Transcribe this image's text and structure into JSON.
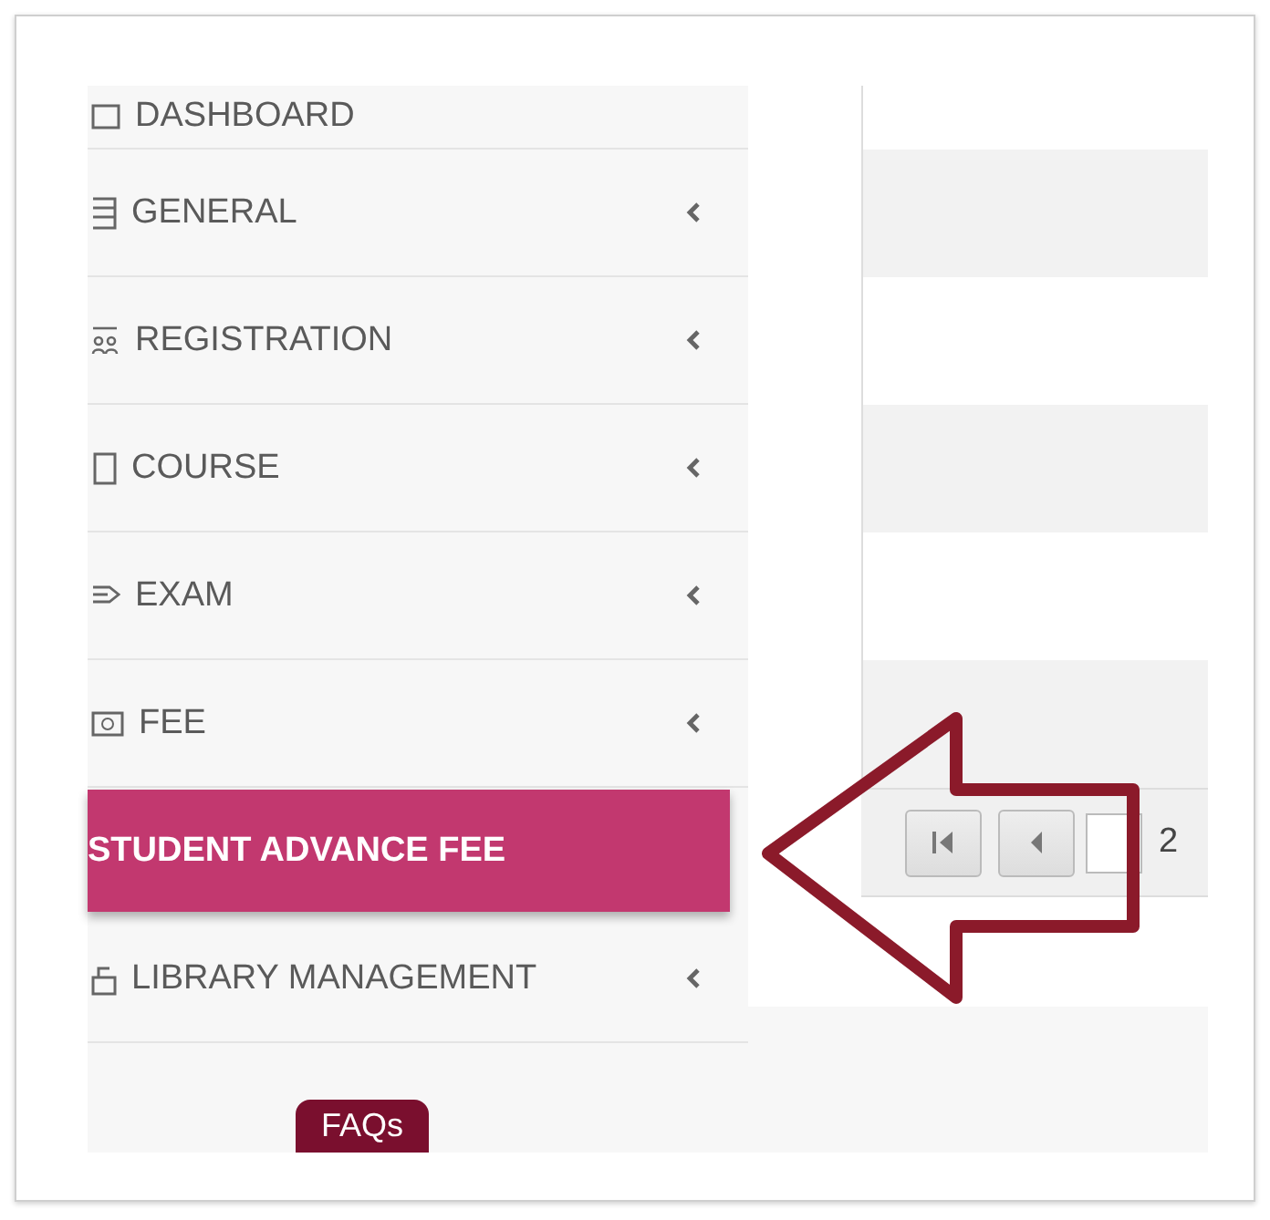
{
  "sidebar": {
    "items": [
      {
        "label": "DASHBOARD",
        "selected": false,
        "expandable": false
      },
      {
        "label": "GENERAL",
        "selected": false,
        "expandable": true
      },
      {
        "label": "REGISTRATION",
        "selected": false,
        "expandable": true
      },
      {
        "label": "COURSE",
        "selected": false,
        "expandable": true
      },
      {
        "label": "EXAM",
        "selected": false,
        "expandable": true
      },
      {
        "label": "FEE",
        "selected": false,
        "expandable": true
      },
      {
        "label": "STUDENT ADVANCE FEE",
        "selected": true,
        "expandable": false
      },
      {
        "label": "LIBRARY MANAGEMENT",
        "selected": false,
        "expandable": true
      }
    ],
    "footer_button": "FAQs"
  },
  "pager": {
    "page_count": "2"
  }
}
